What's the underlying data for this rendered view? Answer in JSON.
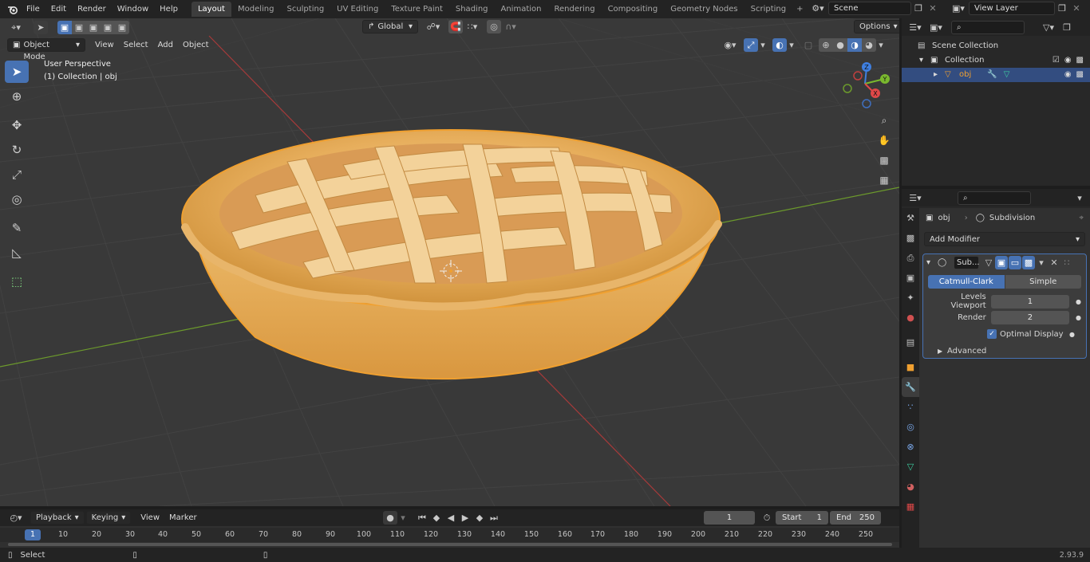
{
  "topbar": {
    "menus": [
      "File",
      "Edit",
      "Render",
      "Window",
      "Help"
    ],
    "workspaces": [
      "Layout",
      "Modeling",
      "Sculpting",
      "UV Editing",
      "Texture Paint",
      "Shading",
      "Animation",
      "Rendering",
      "Compositing",
      "Geometry Nodes",
      "Scripting"
    ],
    "active_workspace": "Layout",
    "add_workspace": "+",
    "scene_name": "Scene",
    "view_layer": "View Layer"
  },
  "viewport": {
    "mode": "Object Mode",
    "menus": [
      "View",
      "Select",
      "Add",
      "Object"
    ],
    "transform_orientation": "Global",
    "options_label": "Options",
    "overlay_line1": "User Perspective",
    "overlay_line2": "(1) Collection | obj",
    "gizmo_axes": {
      "x": "X",
      "y": "Y",
      "z": "Z"
    }
  },
  "outliner": {
    "scene_collection": "Scene Collection",
    "collection": "Collection",
    "object": "obj"
  },
  "properties": {
    "object_name": "obj",
    "modifier_breadcrumb": "Subdivision",
    "add_modifier": "Add Modifier",
    "modifier_short_name": "Sub...",
    "catmull_clark": "Catmull-Clark",
    "simple": "Simple",
    "levels_viewport_label": "Levels Viewport",
    "levels_viewport_value": "1",
    "render_label": "Render",
    "render_value": "2",
    "optimal_display": "Optimal Display",
    "advanced": "Advanced"
  },
  "timeline": {
    "menus": [
      "Playback",
      "Keying",
      "View",
      "Marker"
    ],
    "current_frame": "1",
    "start_label": "Start",
    "start_value": "1",
    "end_label": "End",
    "end_value": "250",
    "ruler_ticks": [
      "10",
      "20",
      "30",
      "40",
      "50",
      "60",
      "70",
      "80",
      "90",
      "100",
      "110",
      "120",
      "130",
      "140",
      "150",
      "160",
      "170",
      "180",
      "190",
      "200",
      "210",
      "220",
      "230",
      "240",
      "250"
    ],
    "ruler_current": "1"
  },
  "statusbar": {
    "left": "Select",
    "version": "2.93.9"
  },
  "colors": {
    "accent": "#4772b3",
    "selection_outline": "#f0a030",
    "x_axis": "#e04848",
    "y_axis": "#7ab82e",
    "z_axis": "#3f7fe0"
  }
}
